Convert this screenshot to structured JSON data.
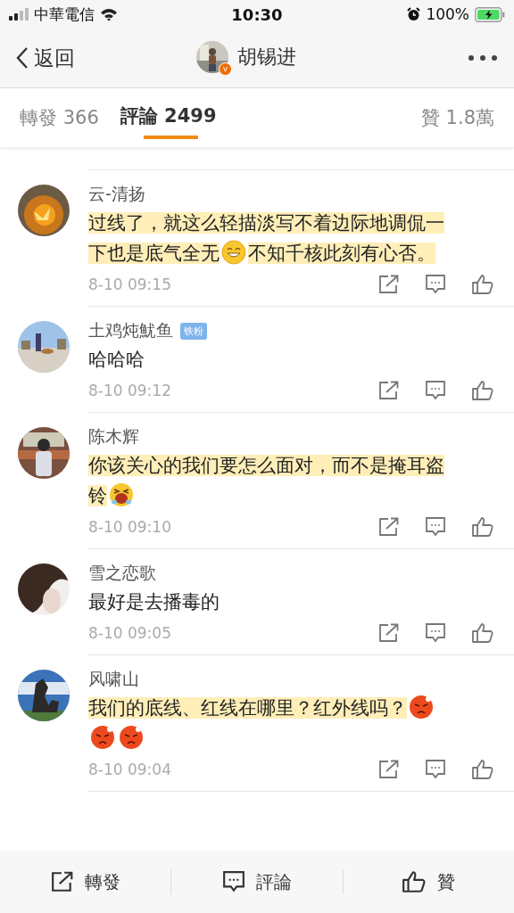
{
  "status_bar": {
    "carrier": "中華電信",
    "time": "10:30",
    "battery": "100%"
  },
  "nav": {
    "back": "返回",
    "title": "胡锡进",
    "verified_badge": "v"
  },
  "tabs": [
    {
      "label": "轉發 366",
      "selected": false
    },
    {
      "label": "評論 2499",
      "selected": true
    }
  ],
  "likes_tab": "贊 1.8萬",
  "comments": [
    {
      "name": "云-清扬",
      "highlighted": true,
      "lines": [
        [
          {
            "kind": "text",
            "text": "过线了，就这么轻描淡写不着边际地调侃一"
          }
        ],
        [
          {
            "kind": "text",
            "text": "下也是底气全无"
          },
          {
            "kind": "grin"
          },
          {
            "kind": "text",
            "text": "不知千核此刻有心否。"
          }
        ]
      ],
      "time": "8-10 09:15"
    },
    {
      "name": "土鸡炖魷鱼",
      "badge": "铁粉",
      "highlighted": false,
      "lines": [
        [
          {
            "kind": "text",
            "text": "哈哈哈"
          }
        ]
      ],
      "time": "8-10 09:12"
    },
    {
      "name": "陈木辉",
      "highlighted": true,
      "lines": [
        [
          {
            "kind": "text",
            "text": "你该关心的我们要怎么面对，而不是掩耳盗"
          }
        ],
        [
          {
            "kind": "text",
            "text": "铃"
          },
          {
            "kind": "bawl"
          }
        ]
      ],
      "time": "8-10 09:10"
    },
    {
      "name": "雪之恋歌",
      "highlighted": false,
      "lines": [
        [
          {
            "kind": "text",
            "text": "最好是去播毒的"
          }
        ]
      ],
      "time": "8-10 09:05"
    },
    {
      "name": "风啸山",
      "highlighted": true,
      "lines": [
        [
          {
            "kind": "text",
            "text": "我们的底线、红线在哪里？红外线吗？"
          },
          {
            "kind": "angry"
          }
        ],
        [
          {
            "kind": "angry"
          },
          {
            "kind": "angry"
          }
        ]
      ],
      "time": "8-10 09:04"
    }
  ],
  "bottom_bar": [
    {
      "kind": "share",
      "label": "轉發"
    },
    {
      "kind": "comment",
      "label": "評論"
    },
    {
      "kind": "like",
      "label": "贊"
    }
  ]
}
